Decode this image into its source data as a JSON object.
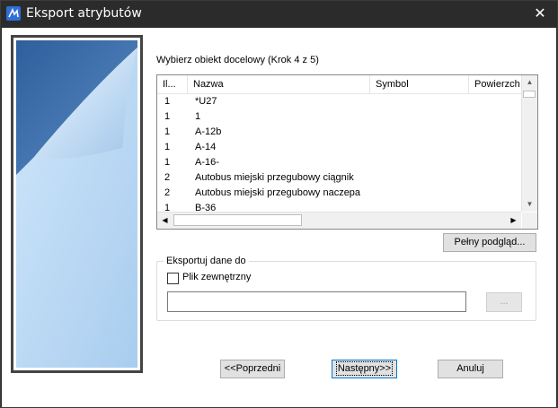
{
  "window": {
    "title": "Eksport atrybutów",
    "close_glyph": "✕"
  },
  "icons": {
    "app": "app-logo-icon",
    "close": "close-icon",
    "check": "checkbox"
  },
  "step": {
    "label": "Wybierz obiekt docelowy (Krok 4 z 5)"
  },
  "list": {
    "columns": [
      "Il...",
      "Nazwa",
      "Symbol",
      "Powierzch"
    ],
    "rows": [
      [
        "1",
        "*U27"
      ],
      [
        "1",
        "1"
      ],
      [
        "1",
        "A-12b"
      ],
      [
        "1",
        "A-14"
      ],
      [
        "1",
        "A-16-"
      ],
      [
        "2",
        "Autobus miejski przegubowy ciągnik"
      ],
      [
        "2",
        "Autobus miejski przegubowy naczepa"
      ],
      [
        "1",
        "B-36"
      ]
    ]
  },
  "buttons": {
    "preview": "Pełny podgląd...",
    "browse": "...",
    "prev": "<<Poprzedni",
    "next": "Następny>>",
    "cancel": "Anuluj"
  },
  "export_group": {
    "legend": "Eksportuj dane do",
    "checkbox_label": "Plik zewnętrzny",
    "checked": false,
    "path_value": ""
  },
  "colors": {
    "accent": "#0078d7",
    "title_bg": "#2b2b2b",
    "panel_blue": "#c5def5"
  }
}
